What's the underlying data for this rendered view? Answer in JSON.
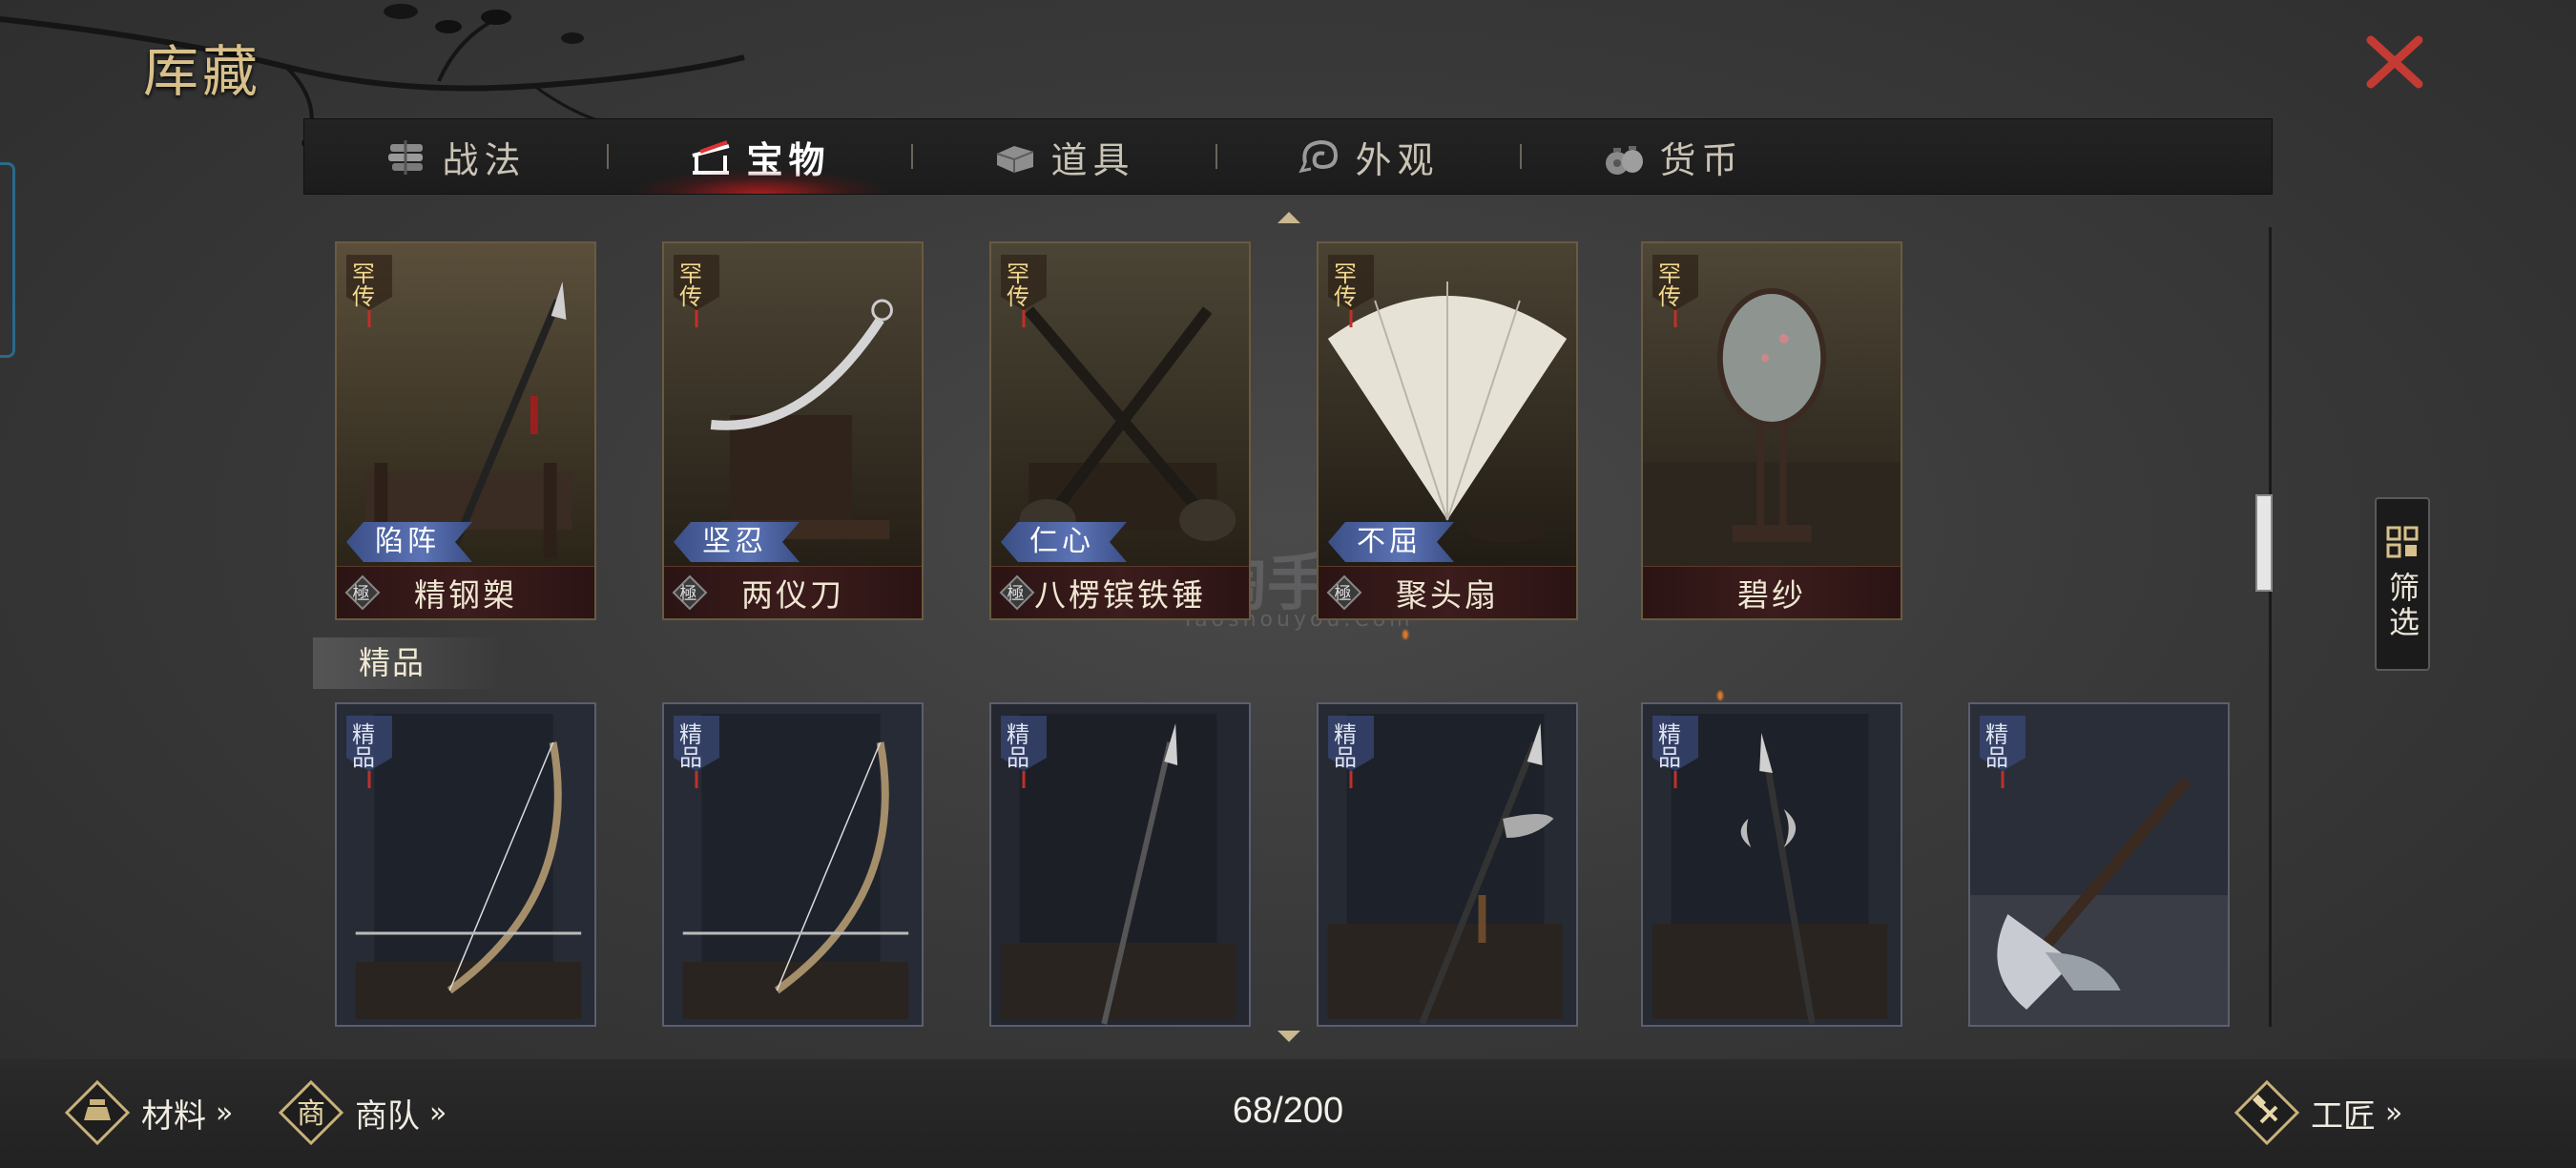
{
  "header": {
    "title": "库藏"
  },
  "tabs": [
    {
      "label": "战法",
      "icon": "scroll-bundle-icon",
      "active": false
    },
    {
      "label": "宝物",
      "icon": "weapon-rack-icon",
      "active": true
    },
    {
      "label": "道具",
      "icon": "chest-icon",
      "active": false
    },
    {
      "label": "外观",
      "icon": "swirl-icon",
      "active": false
    },
    {
      "label": "货币",
      "icon": "money-bag-icon",
      "active": false
    }
  ],
  "legend_items": [
    {
      "grade": "罕传",
      "trait": "陷阵",
      "quality": "極",
      "name": "精钢槊"
    },
    {
      "grade": "罕传",
      "trait": "坚忍",
      "quality": "極",
      "name": "两仪刀"
    },
    {
      "grade": "罕传",
      "trait": "仁心",
      "quality": "極",
      "name": "八楞镔铁锤"
    },
    {
      "grade": "罕传",
      "trait": "不屈",
      "quality": "極",
      "name": "聚头扇"
    },
    {
      "grade": "罕传",
      "trait": "",
      "quality": "",
      "name": "碧纱"
    }
  ],
  "section_fine": {
    "label": "精品"
  },
  "fine_items": [
    {
      "grade": "精品",
      "art": "bow"
    },
    {
      "grade": "精品",
      "art": "bow"
    },
    {
      "grade": "精品",
      "art": "spear"
    },
    {
      "grade": "精品",
      "art": "halberd"
    },
    {
      "grade": "精品",
      "art": "crescent-spear"
    },
    {
      "grade": "精品",
      "art": "axe"
    }
  ],
  "filter": {
    "label": "筛选"
  },
  "footer": {
    "materials_label": "材料",
    "caravan_label": "商队",
    "caravan_badge": "商",
    "craftsman_label": "工匠",
    "capacity": "68/200",
    "chevrons": "»"
  },
  "watermark": {
    "text": "淘手游",
    "sub": "Taoshouyou.Com"
  },
  "colors": {
    "gold": "#d8c08a",
    "close_red": "#c43b34",
    "active_glow": "#be1e1e",
    "trait_blue": "#5c74b6"
  }
}
